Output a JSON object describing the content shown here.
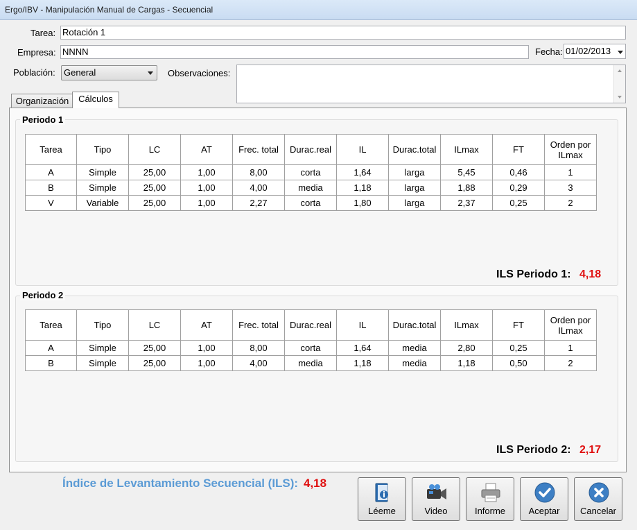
{
  "window": {
    "title": "Ergo/IBV - Manipulación Manual de Cargas - Secuencial"
  },
  "form": {
    "tarea_label": "Tarea:",
    "tarea_value": "Rotación 1",
    "empresa_label": "Empresa:",
    "empresa_value": "NNNN",
    "fecha_label": "Fecha:",
    "fecha_value": "01/02/2013",
    "poblacion_label": "Población:",
    "poblacion_value": "General",
    "observaciones_label": "Observaciones:",
    "observaciones_value": ""
  },
  "tabs": [
    {
      "label": "Organización",
      "active": false
    },
    {
      "label": "Cálculos",
      "active": true
    }
  ],
  "columns": [
    "Tarea",
    "Tipo",
    "LC",
    "AT",
    "Frec. total",
    "Durac.real",
    "IL",
    "Durac.total",
    "ILmax",
    "FT",
    "Orden por ILmax"
  ],
  "periods": [
    {
      "title": "Periodo 1",
      "rows": [
        [
          "A",
          "Simple",
          "25,00",
          "1,00",
          "8,00",
          "corta",
          "1,64",
          "larga",
          "5,45",
          "0,46",
          "1"
        ],
        [
          "B",
          "Simple",
          "25,00",
          "1,00",
          "4,00",
          "media",
          "1,18",
          "larga",
          "1,88",
          "0,29",
          "3"
        ],
        [
          "V",
          "Variable",
          "25,00",
          "1,00",
          "2,27",
          "corta",
          "1,80",
          "larga",
          "2,37",
          "0,25",
          "2"
        ]
      ],
      "ils_label": "ILS Periodo 1:",
      "ils_value": "4,18"
    },
    {
      "title": "Periodo 2",
      "rows": [
        [
          "A",
          "Simple",
          "25,00",
          "1,00",
          "8,00",
          "corta",
          "1,64",
          "media",
          "2,80",
          "0,25",
          "1"
        ],
        [
          "B",
          "Simple",
          "25,00",
          "1,00",
          "4,00",
          "media",
          "1,18",
          "media",
          "1,18",
          "0,50",
          "2"
        ]
      ],
      "ils_label": "ILS Periodo 2:",
      "ils_value": "2,17"
    }
  ],
  "summary": {
    "label": "Índice de Levantamiento Secuencial (ILS):",
    "value": "4,18"
  },
  "buttons": [
    {
      "label": "Léeme",
      "icon": "document-info-icon"
    },
    {
      "label": "Video",
      "icon": "video-camera-icon"
    },
    {
      "label": "Informe",
      "icon": "printer-icon"
    },
    {
      "label": "Aceptar",
      "icon": "checkmark-icon"
    },
    {
      "label": "Cancelar",
      "icon": "cancel-x-icon"
    }
  ],
  "colors": {
    "accent": "#5b9bd5",
    "value_red": "#e01010"
  }
}
